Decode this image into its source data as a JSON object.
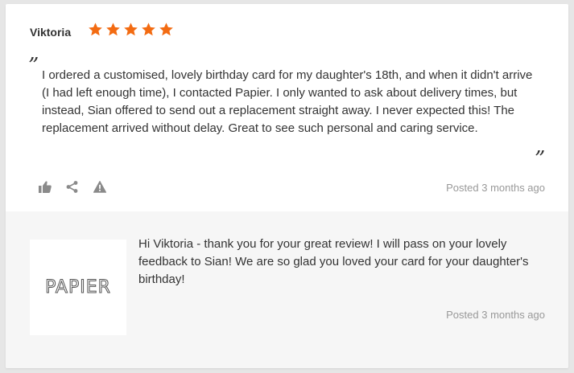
{
  "review": {
    "reviewer_name": "Viktoria",
    "rating": 5,
    "star_color": "#f36b12",
    "quote_open": "”",
    "quote_close": "”",
    "text": "I ordered a customised, lovely birthday card for my daughter's 18th, and when it didn't arrive (I had left enough time), I contacted Papier. I only wanted to ask about delivery times, but instead, Sian offered to send out a replacement straight away. I never expected this! The replacement arrived without delay. Great to see such personal and caring service.",
    "actions": [
      "thumbs-up-icon",
      "share-icon",
      "warning-icon"
    ],
    "posted": "Posted 3 months ago"
  },
  "response": {
    "logo_text": "PAPIER",
    "text": "Hi Viktoria - thank you for your great review! I will pass on your lovely feedback to Sian! We are so glad you loved your card for your daughter's birthday!",
    "posted": "Posted 3 months ago"
  }
}
